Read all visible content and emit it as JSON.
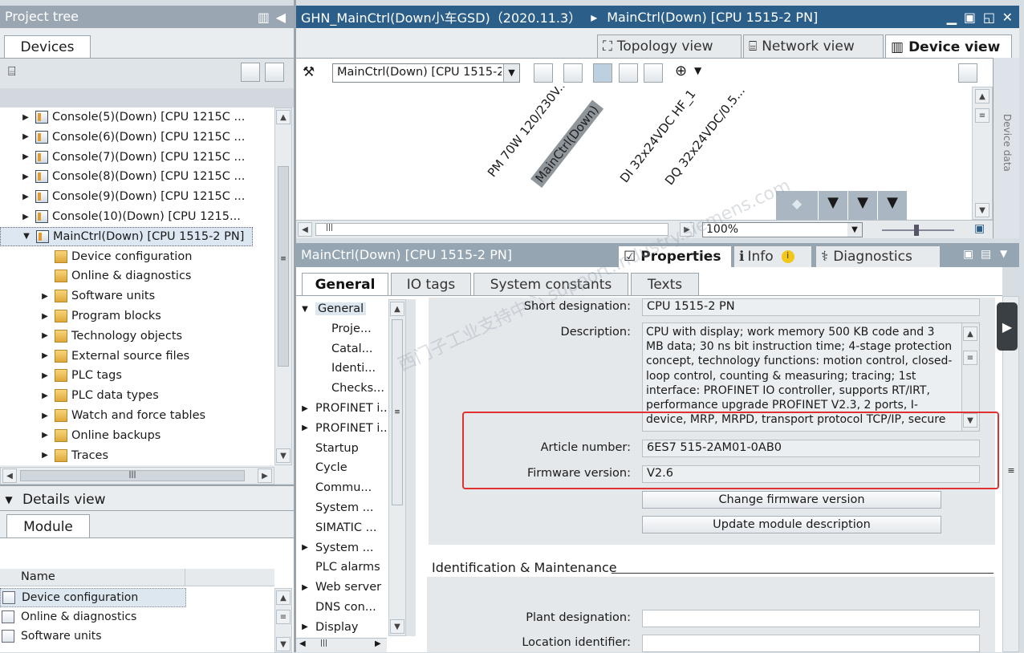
{
  "project_tree": {
    "title": "Project tree",
    "devices_tab": "Devices",
    "items": [
      {
        "label": "Console(5)(Down) [CPU 1215C ...",
        "level": 0
      },
      {
        "label": "Console(6)(Down) [CPU 1215C ...",
        "level": 0
      },
      {
        "label": "Console(7)(Down) [CPU 1215C ...",
        "level": 0
      },
      {
        "label": "Console(8)(Down) [CPU 1215C ...",
        "level": 0
      },
      {
        "label": "Console(9)(Down) [CPU 1215C ...",
        "level": 0
      },
      {
        "label": "Console(10)(Down) [CPU 1215...",
        "level": 0
      },
      {
        "label": "MainCtrl(Down) [CPU 1515-2 PN]",
        "level": 0
      },
      {
        "label": "Device configuration",
        "level": 1
      },
      {
        "label": "Online & diagnostics",
        "level": 1
      },
      {
        "label": "Software units",
        "level": 1
      },
      {
        "label": "Program blocks",
        "level": 1
      },
      {
        "label": "Technology objects",
        "level": 1
      },
      {
        "label": "External source files",
        "level": 1
      },
      {
        "label": "PLC tags",
        "level": 1
      },
      {
        "label": "PLC data types",
        "level": 1
      },
      {
        "label": "Watch and force tables",
        "level": 1
      },
      {
        "label": "Online backups",
        "level": 1
      },
      {
        "label": "Traces",
        "level": 1
      }
    ]
  },
  "details_view": {
    "title": "Details view",
    "tab": "Module",
    "column_name": "Name",
    "rows": [
      "Device configuration",
      "Online & diagnostics",
      "Software units"
    ]
  },
  "editor": {
    "title": "GHN_MainCtrl(Down小车GSD)（2020.11.3）",
    "breadcrumb": "MainCtrl(Down) [CPU 1515-2 PN]",
    "tabs": {
      "topology": "Topology view",
      "network": "Network view",
      "device": "Device view"
    },
    "device_select": "MainCtrl(Down) [CPU 1515-2 PN]",
    "modules": [
      "PM 70W 120/230V...",
      "MainCtrl(Down)",
      "DI 32x24VDC HF_1",
      "DQ 32x24VDC/0.5..."
    ],
    "zoom": "100%",
    "side_tab": "Device data"
  },
  "properties": {
    "title": "MainCtrl(Down) [CPU 1515-2 PN]",
    "tabs": {
      "properties": "Properties",
      "info": "Info",
      "diagnostics": "Diagnostics"
    },
    "subtabs": [
      "General",
      "IO tags",
      "System constants",
      "Texts"
    ],
    "nav": [
      {
        "label": "General",
        "indent": 0,
        "expanded": true
      },
      {
        "label": "Proje...",
        "indent": 1
      },
      {
        "label": "Catal...",
        "indent": 1
      },
      {
        "label": "Identi...",
        "indent": 1
      },
      {
        "label": "Checks...",
        "indent": 1
      },
      {
        "label": "PROFINET i...",
        "indent": 0,
        "expandable": true
      },
      {
        "label": "PROFINET i...",
        "indent": 0,
        "expandable": true
      },
      {
        "label": "Startup",
        "indent": 0
      },
      {
        "label": "Cycle",
        "indent": 0
      },
      {
        "label": "Commu...",
        "indent": 0
      },
      {
        "label": "System ...",
        "indent": 0
      },
      {
        "label": "SIMATIC ...",
        "indent": 0
      },
      {
        "label": "System ...",
        "indent": 0,
        "expandable": true
      },
      {
        "label": "PLC alarms",
        "indent": 0
      },
      {
        "label": "Web server",
        "indent": 0,
        "expandable": true
      },
      {
        "label": "DNS con...",
        "indent": 0
      },
      {
        "label": "Display",
        "indent": 0,
        "expandable": true
      }
    ],
    "short_designation_label": "Short designation:",
    "short_designation": "CPU 1515-2 PN",
    "description_label": "Description:",
    "description": "CPU with display; work memory 500 KB code and 3 MB data; 30 ns bit instruction time; 4-stage protection concept, technology functions: motion control, closed-loop control, counting & measuring; tracing; 1st interface: PROFINET IO controller, supports RT/IRT, performance upgrade PROFINET V2.3, 2 ports, I-device, MRP, MRPD, transport protocol TCP/IP, secure Open User",
    "article_label": "Article number:",
    "article_number": "6ES7 515-2AM01-0AB0",
    "firmware_label": "Firmware version:",
    "firmware_version": "V2.6",
    "change_firmware_button": "Change firmware version",
    "update_module_button": "Update module description",
    "im_section": "Identification & Maintenance",
    "plant_label": "Plant designation:",
    "location_label": "Location identifier:",
    "watermark": "西门子工业支持中心 support.industry.siemens.com"
  },
  "colors": {
    "highlight_box": "#e03030",
    "title_bar": "#2b5f8a",
    "panel_bg": "#e4e8eb"
  }
}
